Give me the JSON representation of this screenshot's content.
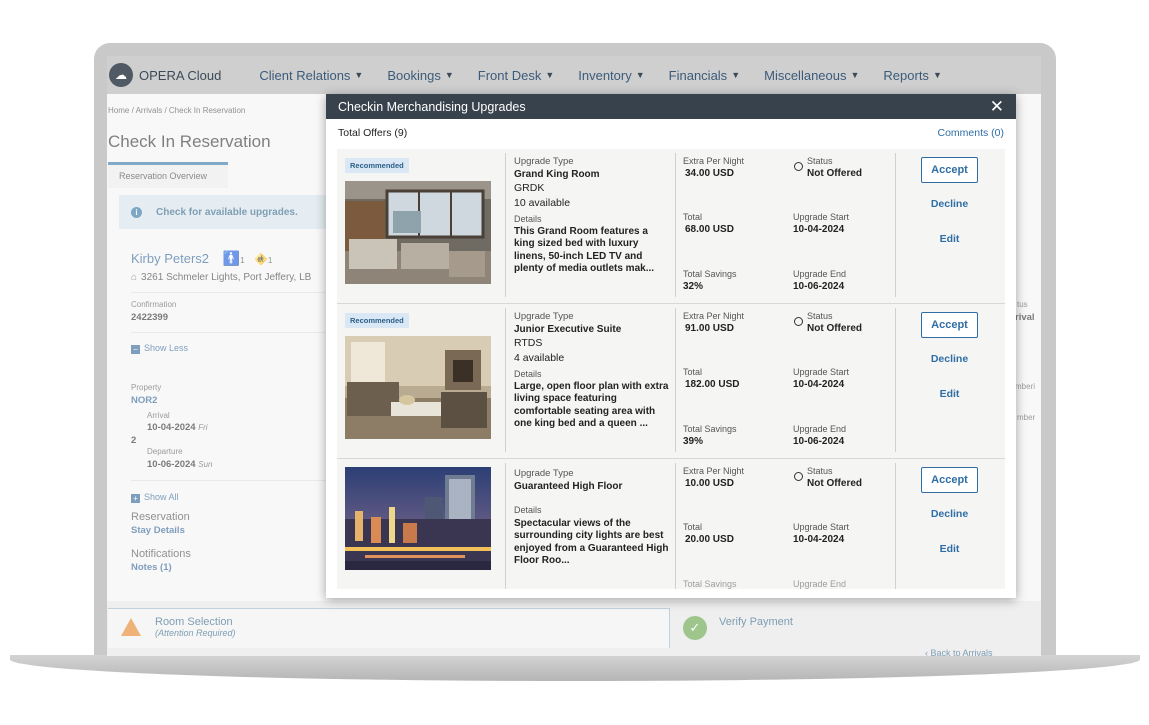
{
  "app": {
    "logo_text": "OPERA Cloud",
    "nav": [
      {
        "label": "Client Relations"
      },
      {
        "label": "Bookings"
      },
      {
        "label": "Front Desk"
      },
      {
        "label": "Inventory"
      },
      {
        "label": "Financials"
      },
      {
        "label": "Miscellaneous"
      },
      {
        "label": "Reports"
      }
    ]
  },
  "page": {
    "breadcrumb": "Home / Arrivals / Check In Reservation",
    "title": "Check In Reservation",
    "tab": "Reservation Overview",
    "banner": "Check for available upgrades.",
    "guest_name": "Kirby Peters2",
    "adults": "1",
    "children": "1",
    "address": "3261 Schmeler Lights, Port Jeffery, LB",
    "confirmation_label": "Confirmation",
    "confirmation_value": "2422399",
    "show_less": "Show Less",
    "property_label": "Property",
    "property_value": "NOR2",
    "arrival_label": "Arrival",
    "arrival_value": "10-04-2024",
    "arrival_day": "Fri",
    "nights": "2",
    "departure_label": "Departure",
    "departure_value": "10-06-2024",
    "departure_day": "Sun",
    "show_all": "Show All",
    "reservation_label": "Reservation",
    "stay_details": "Stay Details",
    "notifications_label": "Notifications",
    "notes_link": "Notes (1)",
    "right_status_partial": "tus",
    "right_status_value_partial": "rival",
    "right_frag1": "mberi",
    "right_frag2": "mber",
    "step_room": "Room Selection",
    "step_room_sub": "(Attention Required)",
    "step_payment": "Verify Payment",
    "back_link": "Back to Arrivals"
  },
  "modal": {
    "title": "Checkin Merchandising Upgrades",
    "total_offers": "Total Offers (9)",
    "comments": "Comments (0)",
    "labels": {
      "upgrade_type": "Upgrade Type",
      "details": "Details",
      "extra_per_night": "Extra Per Night",
      "total": "Total",
      "total_savings": "Total Savings",
      "status": "Status",
      "upgrade_start": "Upgrade Start",
      "upgrade_end": "Upgrade End",
      "accept": "Accept",
      "decline": "Decline",
      "edit": "Edit",
      "recommended": "Recommended"
    },
    "offers": [
      {
        "recommended": true,
        "room_name": "Grand King Room",
        "room_code": "GRDK",
        "availability": "10 available",
        "details": "This Grand Room features a king sized bed with luxury linens, 50-inch LED TV and plenty of media outlets mak...",
        "extra_per_night": "34.00 USD",
        "total": "68.00 USD",
        "total_savings": "32%",
        "status": "Not Offered",
        "upgrade_start": "10-04-2024",
        "upgrade_end": "10-06-2024"
      },
      {
        "recommended": true,
        "room_name": "Junior Executive Suite",
        "room_code": "RTDS",
        "availability": "4 available",
        "details": "Large, open floor plan with extra living space featuring comfortable seating area with one king bed and a queen ...",
        "extra_per_night": "91.00 USD",
        "total": "182.00 USD",
        "total_savings": "39%",
        "status": "Not Offered",
        "upgrade_start": "10-04-2024",
        "upgrade_end": "10-06-2024"
      },
      {
        "recommended": false,
        "room_name": "Guaranteed High Floor",
        "details": "Spectacular views of the surrounding city lights are best enjoyed from a Guaranteed High Floor Roo...",
        "extra_per_night": "10.00 USD",
        "total": "20.00 USD",
        "status": "Not Offered",
        "upgrade_start": "10-04-2024"
      }
    ]
  },
  "colors": {
    "modal_header": "#38424c",
    "link_blue": "#2f6ea5",
    "badge_bg": "#d9e8f4"
  }
}
